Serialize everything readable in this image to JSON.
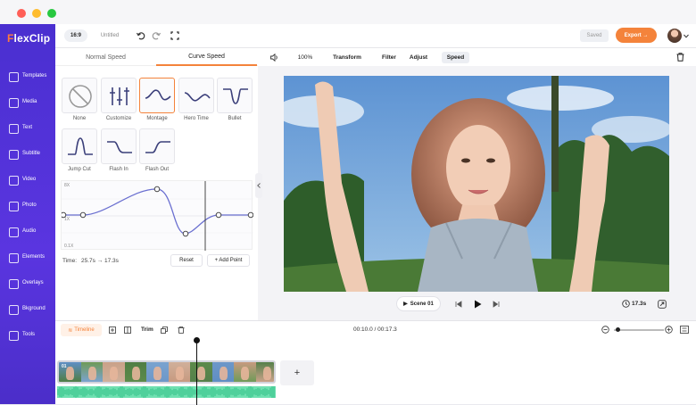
{
  "window": {
    "dots": [
      "#ff5f57",
      "#febc2e",
      "#28c840"
    ]
  },
  "app": {
    "logo_prefix": "F",
    "logo_rest": "lexClip",
    "accent": "#5333d8",
    "orange": "#f4833b"
  },
  "sidebar": {
    "items": [
      {
        "label": "Templates",
        "icon": "templates-icon"
      },
      {
        "label": "Media",
        "icon": "media-icon"
      },
      {
        "label": "Text",
        "icon": "text-icon"
      },
      {
        "label": "Subtitle",
        "icon": "subtitle-icon"
      },
      {
        "label": "Video",
        "icon": "video-icon"
      },
      {
        "label": "Photo",
        "icon": "photo-icon"
      },
      {
        "label": "Audio",
        "icon": "audio-icon"
      },
      {
        "label": "Elements",
        "icon": "elements-icon"
      },
      {
        "label": "Overlays",
        "icon": "overlays-icon"
      },
      {
        "label": "Bkground",
        "icon": "background-icon"
      },
      {
        "label": "Tools",
        "icon": "tools-icon"
      }
    ]
  },
  "topbar": {
    "ratio": "16:9",
    "project_name": "Untitled",
    "saved": "Saved",
    "export": "Export →"
  },
  "speed_panel": {
    "tabs": [
      "Normal Speed",
      "Curve Speed"
    ],
    "presets": [
      "None",
      "Customize",
      "Montage",
      "Hero Time",
      "Bullet",
      "Jump Cut",
      "Flash In",
      "Flash Out"
    ],
    "selected": "Montage",
    "graph": {
      "y_top": "8X",
      "y_mid": "1X",
      "y_bottom": "0.1X"
    },
    "time_label": "Time:",
    "time_value": "25.7s → 17.3s",
    "reset": "Reset",
    "add_point": "+ Add Point"
  },
  "toolbar": {
    "volume_icon": "volume-icon",
    "zoom": "100%",
    "items": [
      "Transform",
      "Filter",
      "Adjust",
      "Speed"
    ],
    "active": "Speed"
  },
  "player": {
    "scene": "Scene 01",
    "duration": "17.3s"
  },
  "timeline": {
    "label": "Timeline",
    "trim": "Trim",
    "timecode": "00:10.0 / 00:17.3",
    "clip_index": "01"
  }
}
